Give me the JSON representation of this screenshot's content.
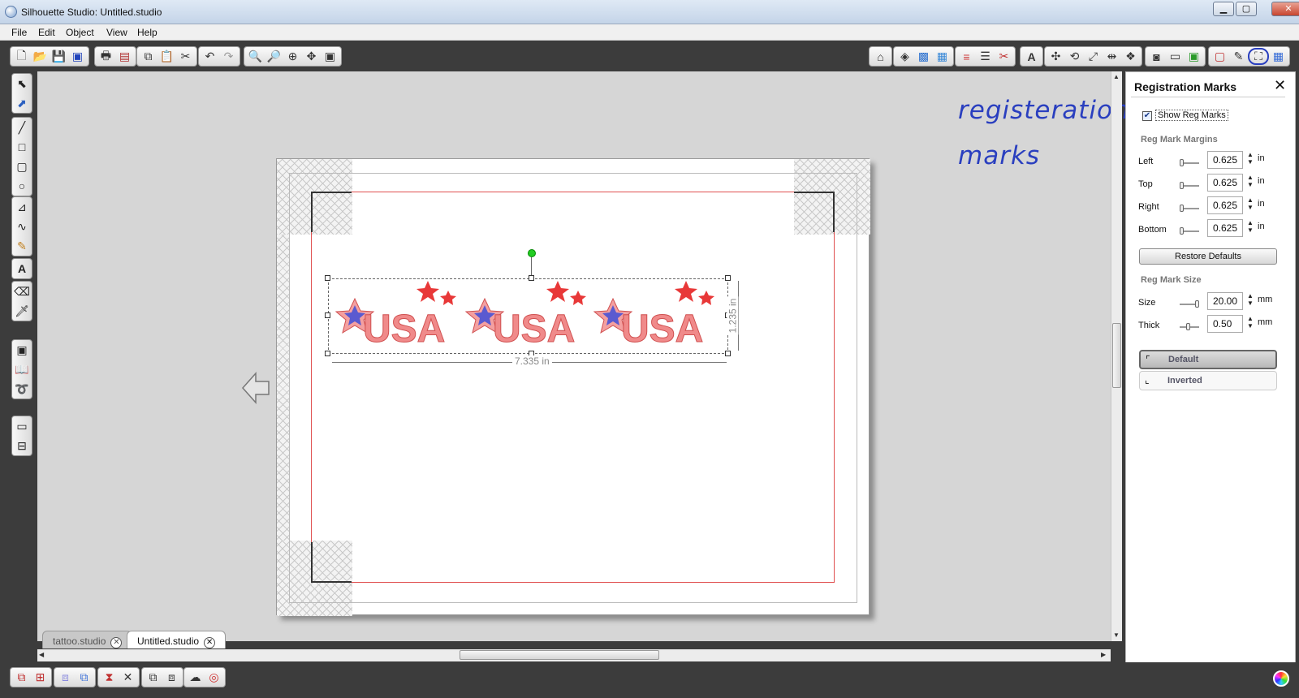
{
  "window": {
    "title": "Silhouette Studio: Untitled.studio",
    "minimize": "▁",
    "maximize": "▢",
    "close": "✕"
  },
  "menu": [
    "File",
    "Edit",
    "Object",
    "View",
    "Help"
  ],
  "tabs": [
    {
      "label": "tattoo.studio",
      "close": "✕"
    },
    {
      "label": "Untitled.studio",
      "close": "✕"
    }
  ],
  "canvas": {
    "width_label": "7.335 in",
    "height_label": "1.235 in",
    "design_text": "USA"
  },
  "annotation": {
    "line1": "registeration",
    "line2": "marks"
  },
  "panel": {
    "title": "Registration Marks",
    "close": "✕",
    "show_reg_marks": "Show Reg Marks",
    "show_reg_marks_checked": true,
    "margins_heading": "Reg Mark Margins",
    "margins": [
      {
        "label": "Left",
        "value": "0.625",
        "unit": "in"
      },
      {
        "label": "Top",
        "value": "0.625",
        "unit": "in"
      },
      {
        "label": "Right",
        "value": "0.625",
        "unit": "in"
      },
      {
        "label": "Bottom",
        "value": "0.625",
        "unit": "in"
      }
    ],
    "restore_defaults": "Restore Defaults",
    "size_heading": "Reg Mark Size",
    "size": [
      {
        "label": "Size",
        "value": "20.00",
        "unit": "mm"
      },
      {
        "label": "Thick",
        "value": "0.50",
        "unit": "mm"
      }
    ],
    "style_default": "Default",
    "style_inverted": "Inverted"
  },
  "colors": {
    "accent": "#2a3fbf",
    "cut_line": "#e05050"
  }
}
